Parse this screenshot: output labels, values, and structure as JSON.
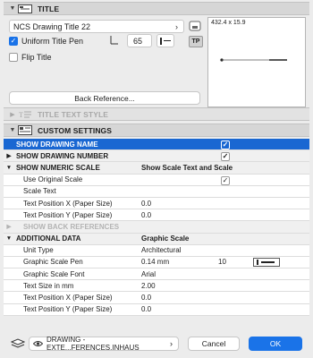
{
  "title_section": {
    "label": "TITLE",
    "title_name": "NCS Drawing Title 22",
    "uniform_title_pen_label": "Uniform Title Pen",
    "uniform_title_pen_checked": true,
    "pen_value": "65",
    "flip_title_label": "Flip Title",
    "flip_title_checked": false,
    "back_reference_button": "Back Reference...",
    "preview_size": "432.4 x 15.9",
    "tp_badge": "TP"
  },
  "title_text_style_section": {
    "label": "TITLE TEXT STYLE"
  },
  "custom_settings_section": {
    "label": "CUSTOM SETTINGS",
    "rows": [
      {
        "name": "SHOW DRAWING NAME",
        "value": "",
        "kind": "selected",
        "checked": true
      },
      {
        "name": "SHOW DRAWING NUMBER",
        "value": "",
        "kind": "group",
        "checked": true
      },
      {
        "name": "SHOW NUMERIC SCALE",
        "value": "Show Scale Text and Scale",
        "kind": "group-open"
      },
      {
        "name": "Use Original Scale",
        "value": "",
        "kind": "item",
        "checked": true
      },
      {
        "name": "Scale Text",
        "value": "",
        "kind": "item"
      },
      {
        "name": "Text Position X (Paper Size)",
        "value": "0.0",
        "kind": "item"
      },
      {
        "name": "Text Position Y (Paper Size)",
        "value": "0.0",
        "kind": "item"
      },
      {
        "name": "SHOW BACK REFERENCES",
        "value": "",
        "kind": "disabled"
      },
      {
        "name": "ADDITIONAL DATA",
        "value": "Graphic Scale",
        "kind": "group-open"
      },
      {
        "name": "Unit Type",
        "value": "Architectural",
        "kind": "item"
      },
      {
        "name": "Graphic Scale Pen",
        "value": "0.14 mm",
        "extra": "10",
        "kind": "item-pen"
      },
      {
        "name": "Graphic Scale Font",
        "value": "Arial",
        "kind": "item"
      },
      {
        "name": "Text Size in mm",
        "value": "2.00",
        "kind": "item"
      },
      {
        "name": "Text Position X (Paper Size)",
        "value": "0.0",
        "kind": "item"
      },
      {
        "name": "Text Position Y (Paper Size)",
        "value": "0.0",
        "kind": "item"
      }
    ]
  },
  "bottom_bar": {
    "layer_label": "DRAWING - EXTE...FERENCES.INHAUS",
    "cancel_label": "Cancel",
    "ok_label": "OK"
  },
  "colors": {
    "accent": "#1a73e8",
    "selected_row": "#1967d2"
  }
}
